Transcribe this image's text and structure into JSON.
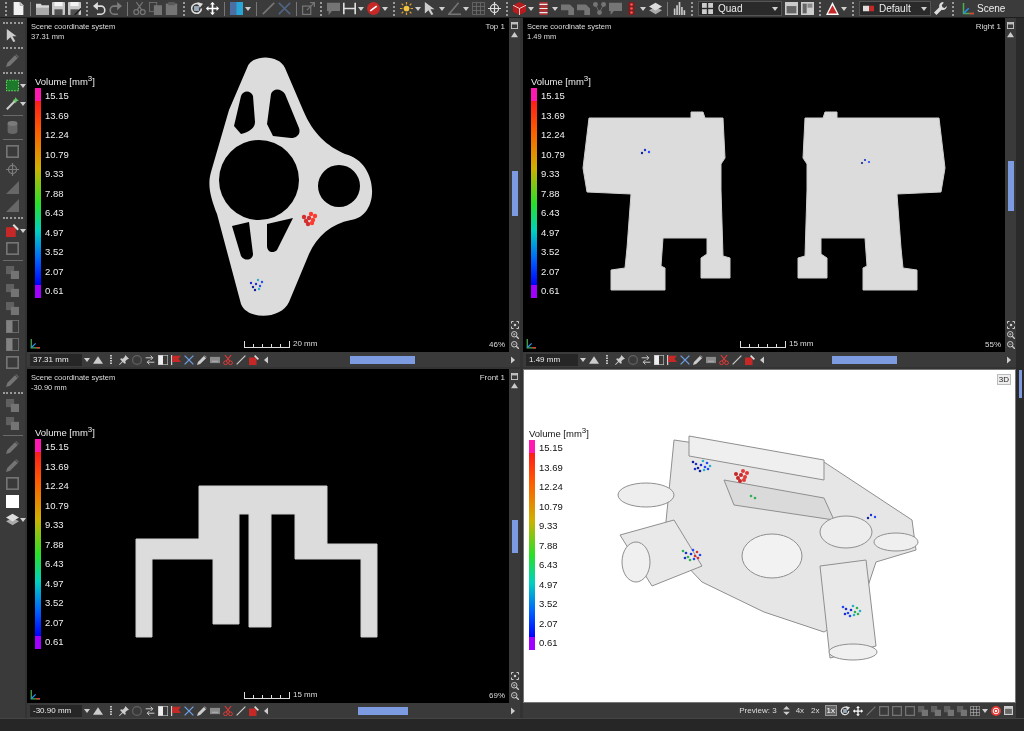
{
  "toolbar": {
    "layout": "Quad",
    "preset": "Default",
    "scene": "Scene"
  },
  "views": [
    {
      "kind": "top",
      "coordinate_system": "Scene coordinate system",
      "position": "37.31 mm",
      "name": "Top 1",
      "legend": {
        "title": "Volume [mm$^{3}$]",
        "ticks": [
          "15.15",
          "13.69",
          "12.24",
          "10.79",
          "9.33",
          "7.88",
          "6.43",
          "4.97",
          "3.52",
          "2.07",
          "0.61"
        ]
      },
      "scale": "20 mm",
      "zoom": "46%",
      "slice_field": "37.31 mm"
    },
    {
      "kind": "right",
      "coordinate_system": "Scene coordinate system",
      "position": "1.49 mm",
      "name": "Right 1",
      "legend": {
        "title": "Volume [mm$^{3}$]",
        "ticks": [
          "15.15",
          "13.69",
          "12.24",
          "10.79",
          "9.33",
          "7.88",
          "6.43",
          "4.97",
          "3.52",
          "2.07",
          "0.61"
        ]
      },
      "scale": "15 mm",
      "zoom": "55%",
      "slice_field": "1.49 mm"
    },
    {
      "kind": "front",
      "coordinate_system": "Scene coordinate system",
      "position": "-30.90 mm",
      "name": "Front 1",
      "legend": {
        "title": "Volume [mm$^{3}$]",
        "ticks": [
          "15.15",
          "13.69",
          "12.24",
          "10.79",
          "9.33",
          "7.88",
          "6.43",
          "4.97",
          "3.52",
          "2.07",
          "0.61"
        ]
      },
      "scale": "15 mm",
      "zoom": "69%",
      "slice_field": "-30.90 mm"
    },
    {
      "kind": "render",
      "name": "3D",
      "legend": {
        "title": "Volume [mm$^{3}$]",
        "ticks": [
          "15.15",
          "13.69",
          "12.24",
          "10.79",
          "9.33",
          "7.88",
          "6.43",
          "4.97",
          "3.52",
          "2.07",
          "0.61"
        ]
      },
      "preview": "Preview: 3",
      "quality": [
        {
          "label": "4x",
          "selected": false
        },
        {
          "label": "2x",
          "selected": false
        },
        {
          "label": "1x",
          "selected": true
        }
      ]
    }
  ]
}
